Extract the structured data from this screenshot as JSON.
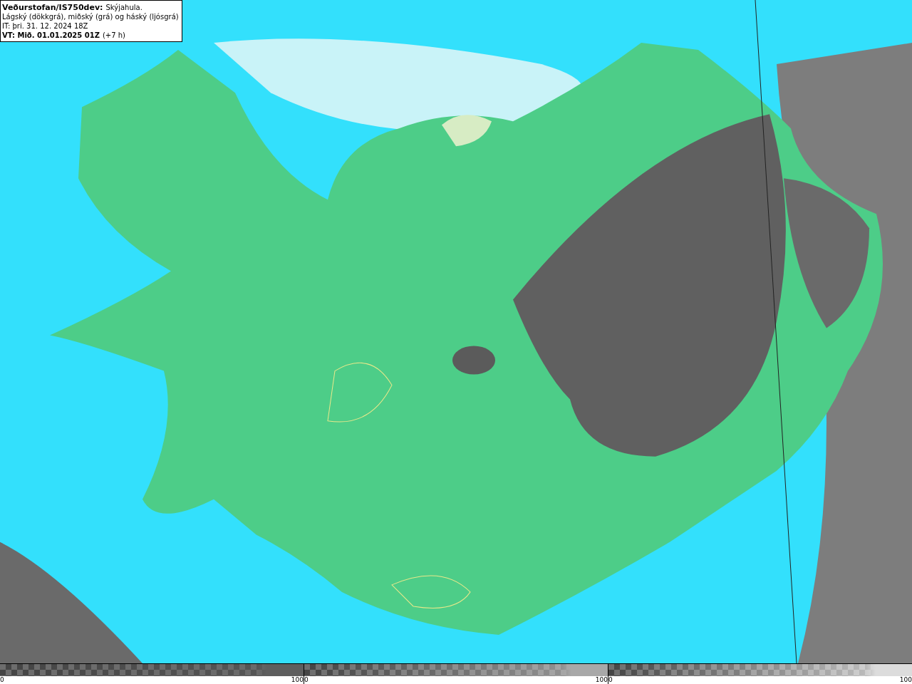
{
  "header": {
    "source": "Veðurstofan/IS750dev:",
    "product": "Skýjahula.",
    "description": "Lágský (dökkgrá), miðský (grá) og háský (ljósgrá)",
    "issue_time": "IT: þri. 31. 12. 2024 18Z",
    "valid_time": "VT: Mið. 01.01.2025 01Z",
    "valid_offset": "(+7 h)"
  },
  "legends": [
    {
      "min": "0",
      "max": "100",
      "color": "#5e5e5e"
    },
    {
      "min": "0",
      "max": "100",
      "color": "#a8a8a8"
    },
    {
      "min": "0",
      "max": "100",
      "color": "#dcdcdc"
    }
  ]
}
